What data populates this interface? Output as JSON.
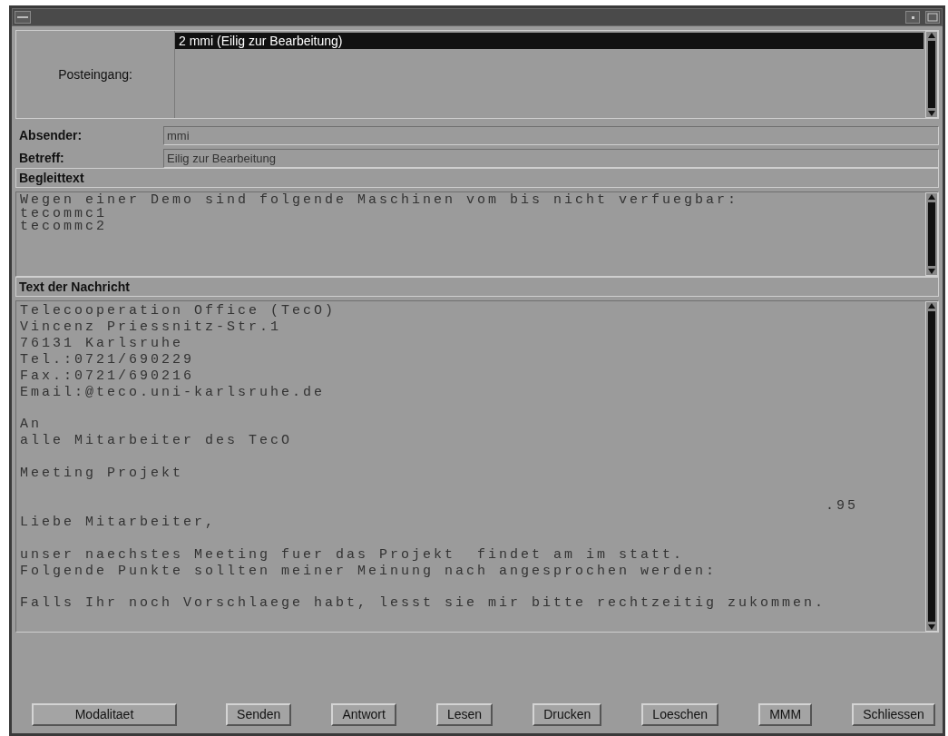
{
  "inbox": {
    "label": "Posteingang:",
    "items": [
      {
        "text": "2 mmi (Eilig zur Bearbeitung)",
        "selected": true
      }
    ]
  },
  "fields": [
    {
      "label": "Absender:",
      "value": "mmi"
    },
    {
      "label": "Betreff:",
      "value": "Eilig zur Bearbeitung"
    }
  ],
  "cover_text": {
    "heading": "Begleittext",
    "text": "Wegen einer Demo sind folgende Maschinen vom bis nicht verfuegbar:\ntecommc1\ntecommc2"
  },
  "message": {
    "heading": "Text der Nachricht",
    "text": "Telecooperation Office (TecO)\nVincenz Priessnitz-Str.1\n76131 Karlsruhe\nTel.:0721/690229\nFax.:0721/690216\nEmail:@teco.uni-karlsruhe.de\n\nAn\nalle Mitarbeiter des TecO\n\nMeeting Projekt\n\n                                                                          .95\nLiebe Mitarbeiter,\n\nunser naechstes Meeting fuer das Projekt  findet am im statt.\nFolgende Punkte sollten meiner Meinung nach angesprochen werden:\n\nFalls Ihr noch Vorschlaege habt, lesst sie mir bitte rechtzeitig zukommen."
  },
  "buttons": [
    "Modalitaet",
    "Senden",
    "Antwort",
    "Lesen",
    "Drucken",
    "Loeschen",
    "MMM",
    "Schliessen"
  ]
}
